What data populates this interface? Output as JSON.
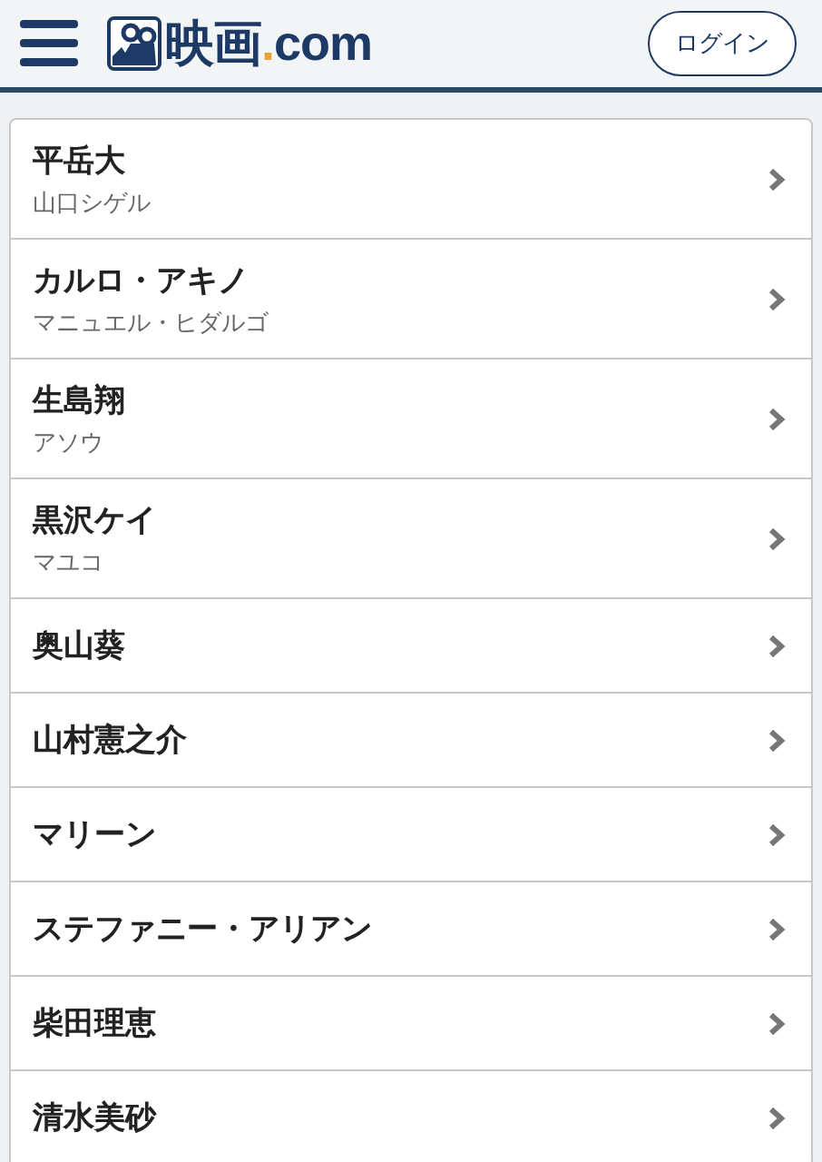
{
  "header": {
    "logo": {
      "part_1": "映画",
      "part_2": ".",
      "part_3": "com"
    },
    "login_button": "ログイン"
  },
  "cast": [
    {
      "name": "平岳大",
      "role": "山口シゲル"
    },
    {
      "name": "カルロ・アキノ",
      "role": "マニュエル・ヒダルゴ"
    },
    {
      "name": "生島翔",
      "role": "アソウ"
    },
    {
      "name": "黒沢ケイ",
      "role": "マユコ"
    },
    {
      "name": "奥山葵"
    },
    {
      "name": "山村憲之介"
    },
    {
      "name": "マリーン"
    },
    {
      "name": "ステファニー・アリアン"
    },
    {
      "name": "柴田理恵"
    },
    {
      "name": "清水美砂"
    }
  ]
}
